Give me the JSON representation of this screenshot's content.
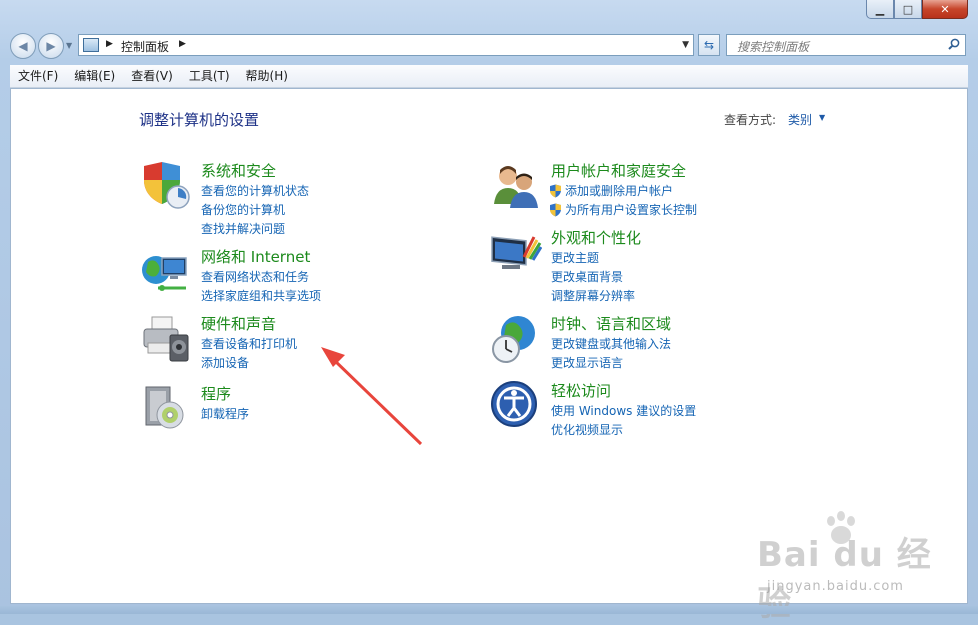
{
  "titlebar": {
    "min_icon": "minimize-icon",
    "max_icon": "maximize-icon",
    "close_icon": "close-icon"
  },
  "navbar": {
    "address_segments": [
      "控制面板"
    ],
    "search_placeholder": "搜索控制面板"
  },
  "menu": [
    "文件(F)",
    "编辑(E)",
    "查看(V)",
    "工具(T)",
    "帮助(H)"
  ],
  "content": {
    "title": "调整计算机的设置",
    "view_by_label": "查看方式:",
    "view_by_value": "类别"
  },
  "categories_left": [
    {
      "title": "系统和安全",
      "icon": "shield-icon",
      "links": [
        "查看您的计算机状态",
        "备份您的计算机",
        "查找并解决问题"
      ]
    },
    {
      "title": "网络和 Internet",
      "icon": "network-icon",
      "links": [
        "查看网络状态和任务",
        "选择家庭组和共享选项"
      ]
    },
    {
      "title": "硬件和声音",
      "icon": "printer-icon",
      "links": [
        "查看设备和打印机",
        "添加设备"
      ]
    },
    {
      "title": "程序",
      "icon": "programs-icon",
      "links": [
        "卸载程序"
      ]
    }
  ],
  "categories_right": [
    {
      "title": "用户帐户和家庭安全",
      "icon": "users-icon",
      "links": [
        "添加或删除用户帐户",
        "为所有用户设置家长控制"
      ],
      "link_shields": true
    },
    {
      "title": "外观和个性化",
      "icon": "monitor-icon",
      "links": [
        "更改主题",
        "更改桌面背景",
        "调整屏幕分辨率"
      ]
    },
    {
      "title": "时钟、语言和区域",
      "icon": "globe-clock-icon",
      "links": [
        "更改键盘或其他输入法",
        "更改显示语言"
      ]
    },
    {
      "title": "轻松访问",
      "icon": "accessibility-icon",
      "links": [
        "使用 Windows 建议的设置",
        "优化视频显示"
      ]
    }
  ],
  "watermark": {
    "logo": "Bai du 经验",
    "sub": "jingyan.baidu.com"
  },
  "annotation": {
    "arrow_color": "#e8453c"
  }
}
